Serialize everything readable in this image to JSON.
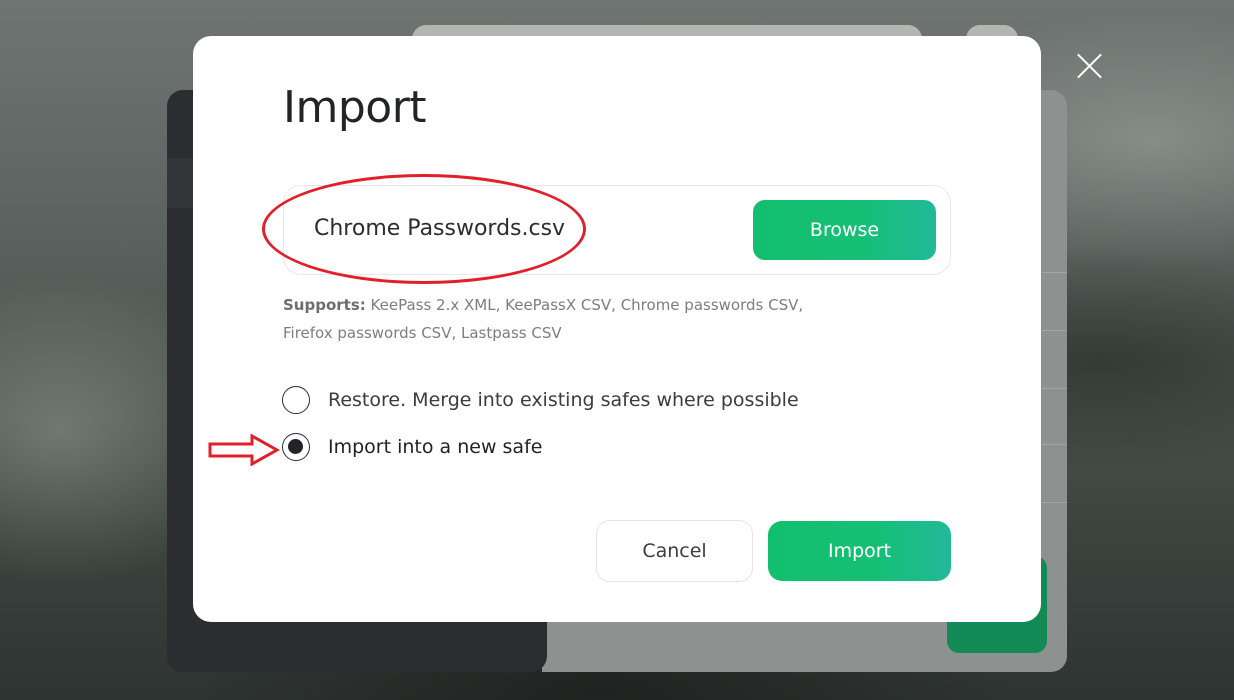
{
  "modal": {
    "title": "Import",
    "file": {
      "name": "Chrome Passwords.csv",
      "browse_label": "Browse"
    },
    "supports": {
      "label": "Supports:",
      "formats": "KeePass 2.x XML, KeePassX CSV, Chrome passwords CSV, Firefox passwords CSV, Lastpass CSV"
    },
    "options": [
      {
        "label": "Restore. Merge into existing safes where possible",
        "selected": false
      },
      {
        "label": "Import into a new safe",
        "selected": true
      }
    ],
    "cancel_label": "Cancel",
    "import_label": "Import"
  },
  "annotations": {
    "color": "#e0202a",
    "shapes": [
      "ellipse-around-file-name",
      "arrow-pointing-to-selected-option"
    ]
  },
  "colors": {
    "accent_start": "#12bf6e",
    "accent_end": "#22b99a"
  },
  "icons": {
    "close": "close-icon"
  }
}
